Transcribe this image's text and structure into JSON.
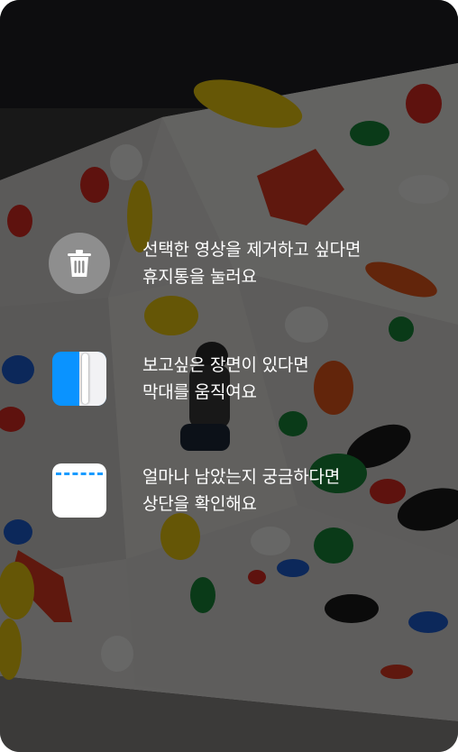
{
  "guide": {
    "tips": [
      {
        "icon": "trash-icon",
        "lines": [
          "선택한 영상을 제거하고 싶다면",
          "휴지통을 눌러요"
        ]
      },
      {
        "icon": "trim-bar-icon",
        "lines": [
          "보고싶은 장면이 있다면",
          "막대를 움직여요"
        ]
      },
      {
        "icon": "progress-indicator-icon",
        "lines": [
          "얼마나 남았는지 궁금하다면",
          "상단을 확인해요"
        ]
      }
    ]
  },
  "colors": {
    "overlay": "rgba(0,0,0,0.58)",
    "accent_blue": "#0a93ff",
    "trash_circle": "#8e8e8e"
  }
}
